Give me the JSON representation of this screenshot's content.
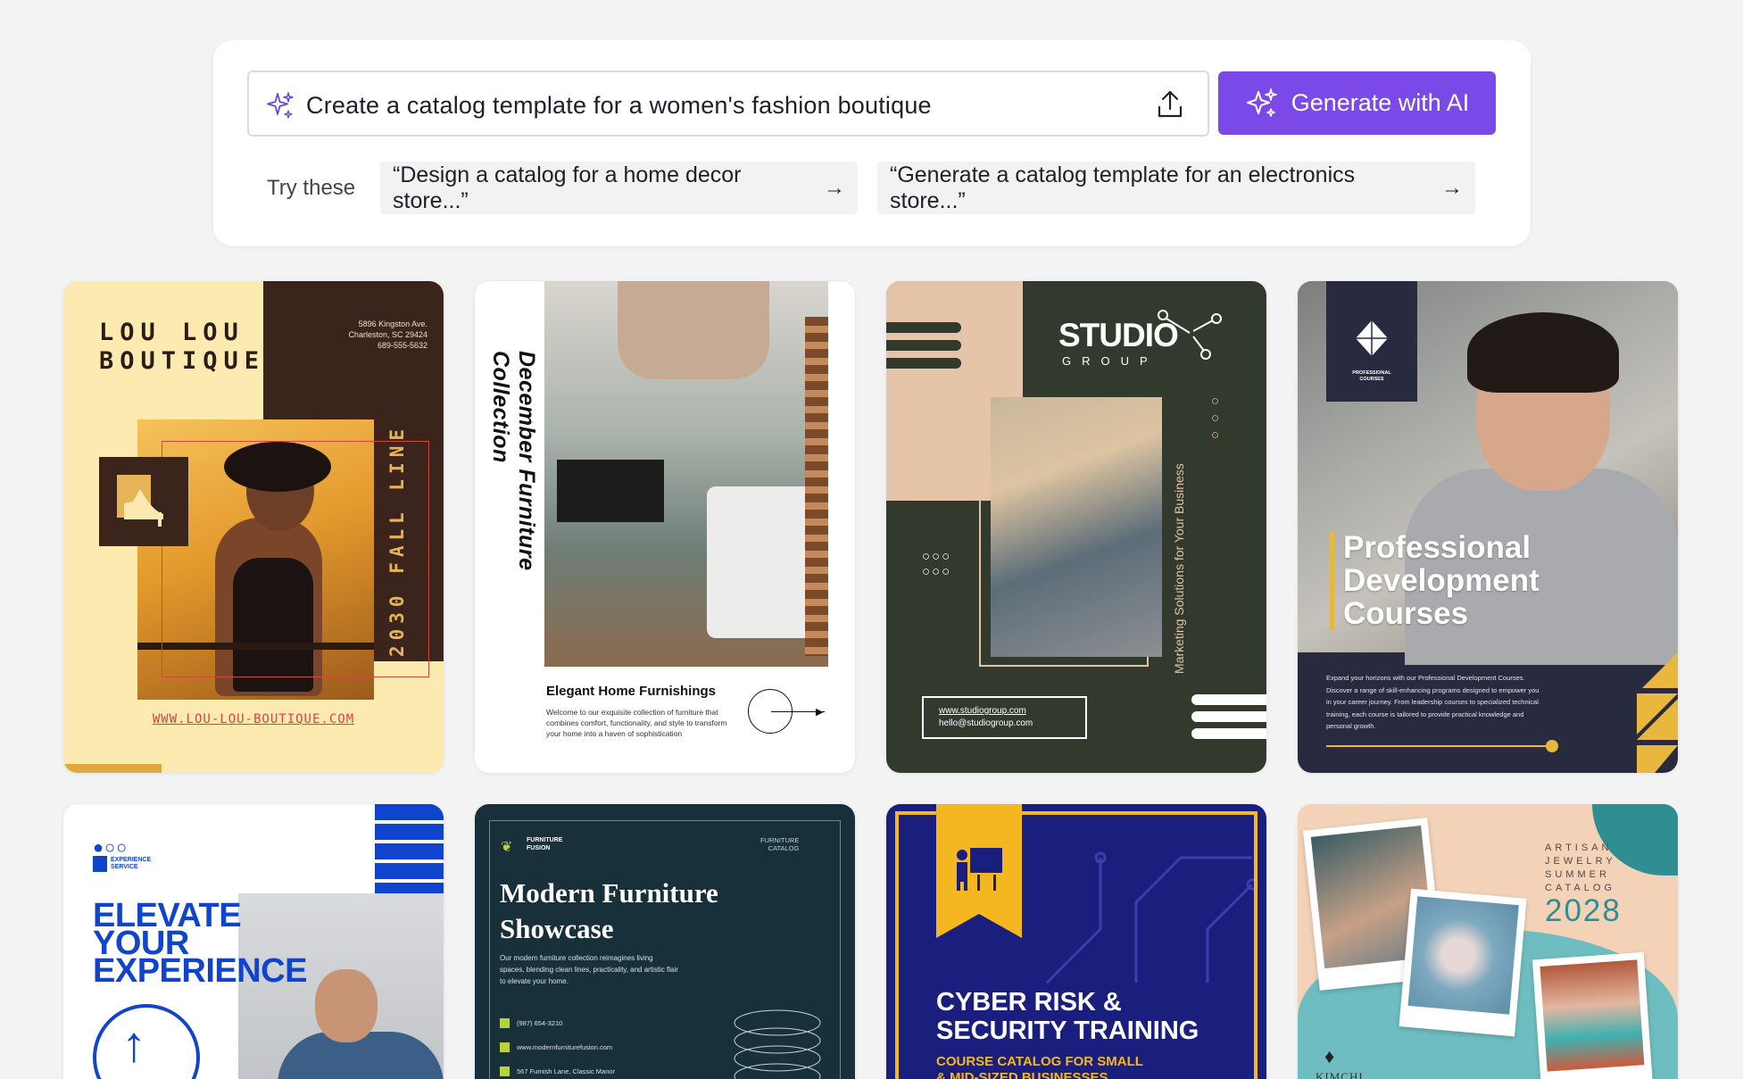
{
  "prompt": {
    "value": "Create a catalog template for a women's fashion boutique",
    "icon": "sparkle-icon",
    "upload_icon": "upload-icon"
  },
  "generate_button": {
    "label": "Generate with AI",
    "color": "#7b49e7"
  },
  "suggestions": {
    "label": "Try these",
    "items": [
      "“Design a catalog for a home decor store...”",
      "“Generate a catalog template for an electronics store...”"
    ],
    "arrow": "→"
  },
  "templates": {
    "lou": {
      "brand": "LOU LOU\nBOUTIQUE",
      "address": "5896 Kingston Ave.\nCharleston, SC 29424\n689-555-5632",
      "season": "2030 FALL LINE",
      "url": "WWW.LOU-LOU-BOUTIQUE.COM"
    },
    "dec": {
      "vertical": "December Furniture Collection",
      "heading": "Elegant Home Furnishings",
      "body": "Welcome to our exquisite collection of furniture that combines comfort, functionality, and style to transform your home into a haven of sophistication"
    },
    "studio": {
      "logo": "STUDIO",
      "group": "GROUP",
      "tagline": "Marketing Solutions for Your Business",
      "web": "www.studiogroup.com",
      "email": "hello@studiogroup.com",
      "dots": "○○○"
    },
    "pro": {
      "badge": "PROFESSIONAL\nCOURSES",
      "title": "Professional\nDevelopment\nCourses",
      "desc": "Expand your horizons with our Professional Development Courses. Discover a range of skill-enhancing programs designed to empower you in your career journey. From leadership courses to specialized technical training, each course is tailored to provide practical knowledge and personal growth."
    },
    "exp": {
      "logo_dots": "●○○",
      "logo": "EXPERIENCE\nSERVICE",
      "title": "ELEVATE\nYOUR\nEXPERIENCE",
      "arrow": "↑"
    },
    "mod": {
      "brand": "FURNITURE\nFUSION",
      "catalog": "FURNITURE\nCATALOG",
      "title": "Modern Furniture\nShowcase",
      "body": "Our modern furniture collection reimagines living spaces, blending clean lines, practicality, and artistic flair to elevate your home.",
      "phone": "(987) 654-3210",
      "web": "www.modernfurniturefusion.com",
      "address": "567 Furnish Lane, Classic Manor"
    },
    "cyber": {
      "title": "CYBER RISK &\nSECURITY TRAINING",
      "sub": "COURSE CATALOG FOR SMALL\n& MID-SIZED BUSINESSES"
    },
    "kimchi": {
      "text": "ARTISAN\nJEWELRY\nSUMMER\nCATALOG",
      "year": "2028",
      "brand": "KIMCHI"
    }
  }
}
